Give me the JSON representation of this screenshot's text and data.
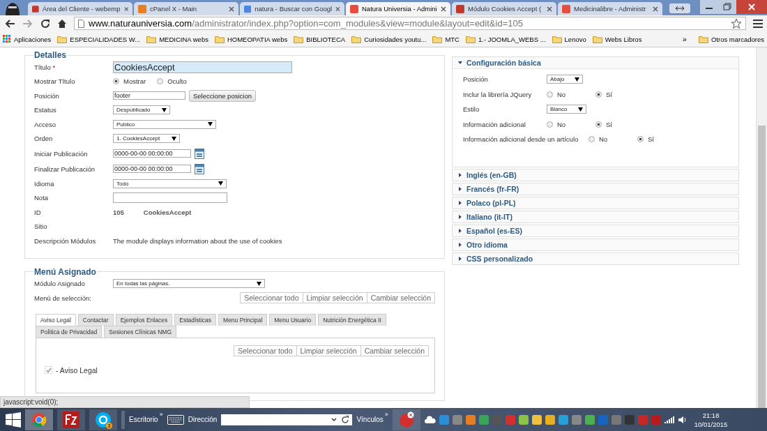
{
  "browser": {
    "tabs": [
      {
        "title": "Área del Cliente - webemp",
        "selected": false
      },
      {
        "title": "cPanel X - Main",
        "selected": false
      },
      {
        "title": "natura - Buscar con Googl",
        "selected": false
      },
      {
        "title": "Natura Universia - Admini",
        "selected": true
      },
      {
        "title": "Módulo Cookies Accept (",
        "selected": false
      },
      {
        "title": "Medicinalibre - Administr",
        "selected": false
      }
    ],
    "url_host": "www.naturauniversia.com",
    "url_path": "/administrator/index.php?option=com_modules&view=module&layout=edit&id=105",
    "bookmarks": [
      {
        "kind": "apps",
        "label": "Aplicaciones"
      },
      {
        "kind": "folder",
        "label": "ESPECIALIDADES W..."
      },
      {
        "kind": "folder",
        "label": "MEDICINA webs"
      },
      {
        "kind": "folder",
        "label": "HOMEOPATIA webs"
      },
      {
        "kind": "folder",
        "label": "BIBLIOTECA"
      },
      {
        "kind": "folder",
        "label": "Curiosidades youtu..."
      },
      {
        "kind": "folder",
        "label": "MTC"
      },
      {
        "kind": "folder",
        "label": "1.- JOOMLA_WEBS ..."
      },
      {
        "kind": "folder",
        "label": "Lenovo"
      },
      {
        "kind": "folder",
        "label": "Webs Libros"
      }
    ],
    "more_bookmarks": "»",
    "other_bookmarks": "Otros marcadores"
  },
  "details": {
    "legend": "Detalles",
    "rows": [
      {
        "kind": "text",
        "label": "Título",
        "required_mark": "*",
        "value": "CookiesAccept",
        "highlighted": true
      },
      {
        "kind": "radio",
        "label": "Mostrar Título",
        "options": [
          {
            "label": "Mostrar",
            "selected": true
          },
          {
            "label": "Oculto",
            "selected": false
          }
        ]
      },
      {
        "kind": "text_button",
        "label": "Posición",
        "value": "footer",
        "button": "Seleccione posicion"
      },
      {
        "kind": "select",
        "label": "Estatus",
        "value": "Despublicado"
      },
      {
        "kind": "select",
        "label": "Acceso",
        "value": "Publico"
      },
      {
        "kind": "select",
        "label": "Orden",
        "value": "1. CookiesAccept"
      },
      {
        "kind": "date",
        "label": "Iniciar Publicación",
        "value": "0000-00-00 00:00:00"
      },
      {
        "kind": "date",
        "label": "Finalizar Publicación",
        "value": "0000-00-00 00:00:00"
      },
      {
        "kind": "select",
        "label": "Idioma",
        "value": "Todo"
      },
      {
        "kind": "text",
        "label": "Nota",
        "value": "",
        "highlighted": false
      },
      {
        "kind": "pair",
        "label": "ID",
        "value": "105",
        "extra": "CookiesAccept"
      },
      {
        "kind": "static",
        "label": "Sitio"
      },
      {
        "kind": "static",
        "label": "Descripción Módulos",
        "value": "The module displays information about the use of cookies"
      }
    ]
  },
  "menu": {
    "legend": "Menú Asignado",
    "assigned_label": "Módulo Asignado",
    "assigned_value": "En todas las páginas.",
    "selection_label": "Menú de selección:",
    "buttons": [
      "Seleccionar todo",
      "Limpiar selección",
      "Cambiar selección"
    ],
    "tabs": [
      {
        "label": "Aviso Legal",
        "selected": true
      },
      {
        "label": "Contactar",
        "selected": false
      },
      {
        "label": "Ejemplos Enlaces",
        "selected": false
      },
      {
        "label": "Estadísticas",
        "selected": false
      },
      {
        "label": "Menu Principal",
        "selected": false
      },
      {
        "label": "Menu Usuario",
        "selected": false
      },
      {
        "label": "Nutrición Energética II",
        "selected": false
      },
      {
        "label": "Politica de Privacidad",
        "selected": false
      },
      {
        "label": "Sesiones Clínicas NMG",
        "selected": false
      }
    ],
    "inner_buttons": [
      "Seleccionar todo",
      "Limpiar selección",
      "Cambiar selección"
    ],
    "items": [
      {
        "label": "- Aviso Legal",
        "checked": true
      }
    ]
  },
  "options": {
    "panels": [
      {
        "title": "Configuración básica",
        "expanded": true,
        "rows": [
          {
            "kind": "select",
            "label": "Posición",
            "value": "Abajo"
          },
          {
            "kind": "radio",
            "label": "Inclur la librería JQuery",
            "options": [
              {
                "label": "No",
                "selected": false
              },
              {
                "label": "Sí",
                "selected": true
              }
            ]
          },
          {
            "kind": "select",
            "label": "Estilo",
            "value": "Blanco"
          },
          {
            "kind": "radio",
            "label": "Información adicional",
            "options": [
              {
                "label": "No",
                "selected": false
              },
              {
                "label": "Sí",
                "selected": true
              }
            ]
          },
          {
            "kind": "radio",
            "label": "Información adicional desde un artículo",
            "options": [
              {
                "label": "No",
                "selected": false
              },
              {
                "label": "Sí",
                "selected": true
              }
            ]
          }
        ]
      },
      {
        "title": "Inglés (en-GB)",
        "expanded": false
      },
      {
        "title": "Francés (fr-FR)",
        "expanded": false
      },
      {
        "title": "Polaco (pl-PL)",
        "expanded": false
      },
      {
        "title": "Italiano (it-IT)",
        "expanded": false
      },
      {
        "title": "Español (es-ES)",
        "expanded": false
      },
      {
        "title": "Otro idioma",
        "expanded": false
      },
      {
        "title": "CSS personalizado",
        "expanded": false
      }
    ]
  },
  "status_text": "javascript:void(0);",
  "taskbar": {
    "skype_badge": "3",
    "desktop_label": "Escritorio",
    "more": "»",
    "address_label": "Dirección",
    "links_label": "Vínculos",
    "links_more": "»",
    "time": "21:18",
    "date": "10/01/2015"
  }
}
